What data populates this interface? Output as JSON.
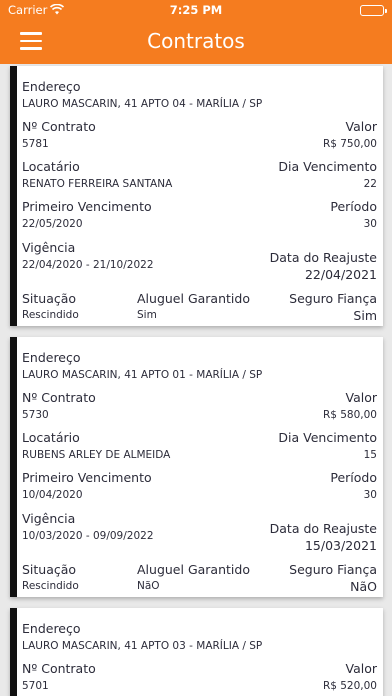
{
  "status_bar": {
    "carrier": "Carrier",
    "time": "7:25 PM"
  },
  "header": {
    "title": "Contratos"
  },
  "labels": {
    "endereco": "Endereço",
    "contrato": "Nº Contrato",
    "valor": "Valor",
    "locatario": "Locatário",
    "dia_vencimento": "Dia Vencimento",
    "primeiro_vencimento": "Primeiro Vencimento",
    "periodo": "Período",
    "vigencia": "Vigência",
    "data_reajuste": "Data do Reajuste",
    "situacao": "Situação",
    "aluguel_garantido": "Aluguel Garantido",
    "seguro_fianca": "Seguro Fiança"
  },
  "contracts": [
    {
      "endereco": "LAURO MASCARIN, 41 APTO 04 - MARÍLIA / SP",
      "contrato": "5781",
      "valor": "R$ 750,00",
      "locatario": "RENATO FERREIRA SANTANA",
      "dia_vencimento": "22",
      "primeiro_vencimento": "22/05/2020",
      "periodo": "30",
      "vigencia": "22/04/2020 - 21/10/2022",
      "data_reajuste": "22/04/2021",
      "situacao": "Rescindido",
      "aluguel_garantido": "Sim",
      "seguro_fianca": "Sim"
    },
    {
      "endereco": "LAURO MASCARIN, 41 APTO 01 - MARÍLIA / SP",
      "contrato": "5730",
      "valor": "R$ 580,00",
      "locatario": "RUBENS ARLEY DE ALMEIDA",
      "dia_vencimento": "15",
      "primeiro_vencimento": "10/04/2020",
      "periodo": "30",
      "vigencia": "10/03/2020 - 09/09/2022",
      "data_reajuste": "15/03/2021",
      "situacao": "Rescindido",
      "aluguel_garantido": "NãO",
      "seguro_fianca": "NãO"
    },
    {
      "endereco": "LAURO MASCARIN, 41 APTO 03 - MARÍLIA / SP",
      "contrato": "5701",
      "valor": "R$ 520,00"
    }
  ],
  "colors": {
    "accent": "#f57c1f",
    "card_bar": "#111111",
    "background": "#e9e9e9"
  }
}
